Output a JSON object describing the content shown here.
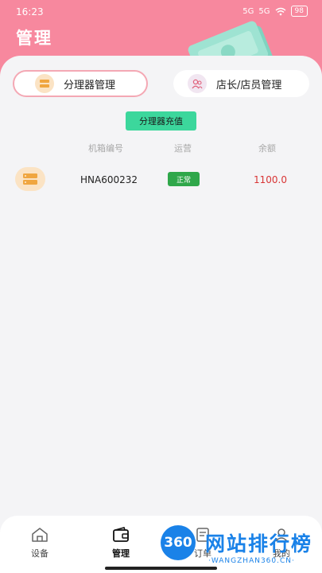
{
  "status_bar": {
    "time": "16:23",
    "signal1": "5G",
    "signal2": "5G",
    "battery": "98"
  },
  "header": {
    "title": "管理"
  },
  "tabs": [
    {
      "label": "分理器管理",
      "active": true
    },
    {
      "label": "店长/店员管理",
      "active": false
    }
  ],
  "recharge_button": "分理器充值",
  "table": {
    "columns": [
      "机箱编号",
      "运营",
      "余额"
    ],
    "rows": [
      {
        "id": "HNA600232",
        "status": "正常",
        "balance": "1100.0"
      }
    ]
  },
  "bottom_nav": [
    {
      "label": "设备",
      "icon": "home-icon",
      "active": false
    },
    {
      "label": "管理",
      "icon": "wallet-icon",
      "active": true
    },
    {
      "label": "订单",
      "icon": "document-icon",
      "active": false
    },
    {
      "label": "我的",
      "icon": "user-icon",
      "active": false
    }
  ],
  "watermark": {
    "badge": "360",
    "text": "网站排行榜",
    "url": "·WANGZHAN360.CN·"
  },
  "colors": {
    "header": "#f7889e",
    "accent_green": "#3cd79c",
    "status_green": "#2fa74a",
    "balance_red": "#d83535"
  }
}
